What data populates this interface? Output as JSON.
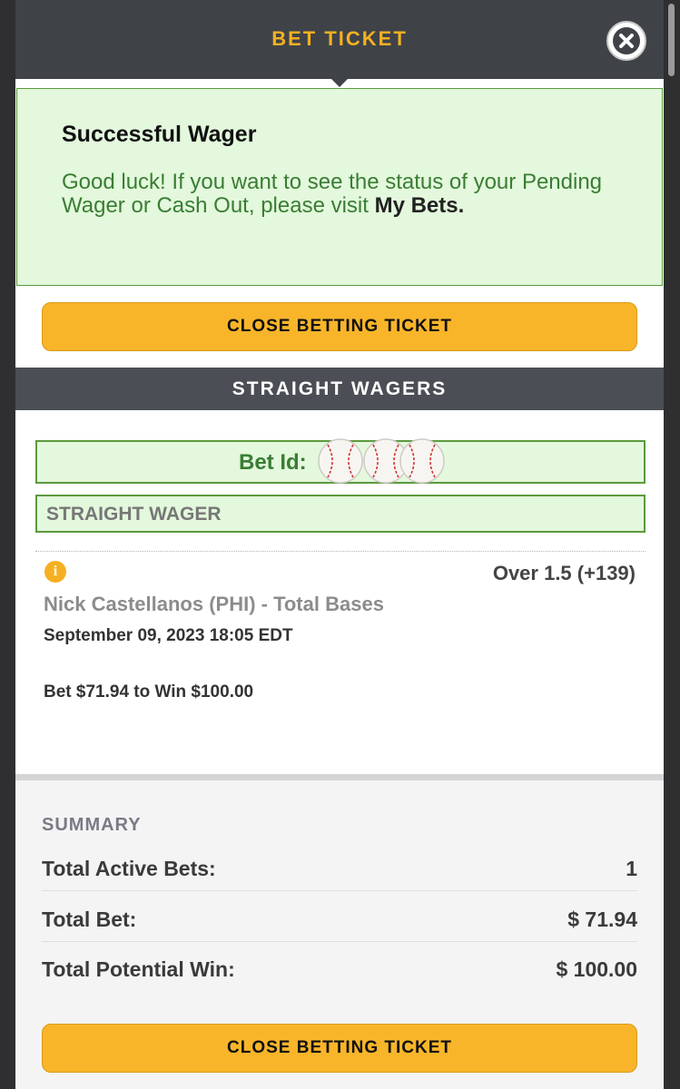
{
  "header": {
    "title": "BET TICKET",
    "close_icon": "close-circle-icon"
  },
  "success": {
    "title": "Successful Wager",
    "message": "Good luck! If you want to see the status of your Pending Wager or Cash Out, please visit",
    "link": "My Bets."
  },
  "buttons": {
    "close_top": "CLOSE BETTING TICKET",
    "close_bottom": "CLOSE BETTING TICKET"
  },
  "section": {
    "title": "STRAIGHT WAGERS"
  },
  "bet": {
    "id_label": "Bet Id:",
    "id_obscured_icon": "baseball-icon",
    "type": "STRAIGHT WAGER",
    "info_icon": "info-icon",
    "pick": "Over 1.5 (+139)",
    "market": "Nick Castellanos (PHI) - Total Bases",
    "datetime": "September 09, 2023 18:05 EDT",
    "bet_to_win": "Bet $71.94 to Win $100.00"
  },
  "summary": {
    "title": "SUMMARY",
    "rows": [
      {
        "label": "Total Active Bets:",
        "value": "1"
      },
      {
        "label": "Total Bet:",
        "value": "$ 71.94"
      },
      {
        "label": "Total Potential Win:",
        "value": "$ 100.00"
      }
    ]
  },
  "colors": {
    "accent": "#f9b52a",
    "header_bg": "#3f4348",
    "success_bg": "#e3f8dc",
    "success_text": "#3a7d34"
  }
}
